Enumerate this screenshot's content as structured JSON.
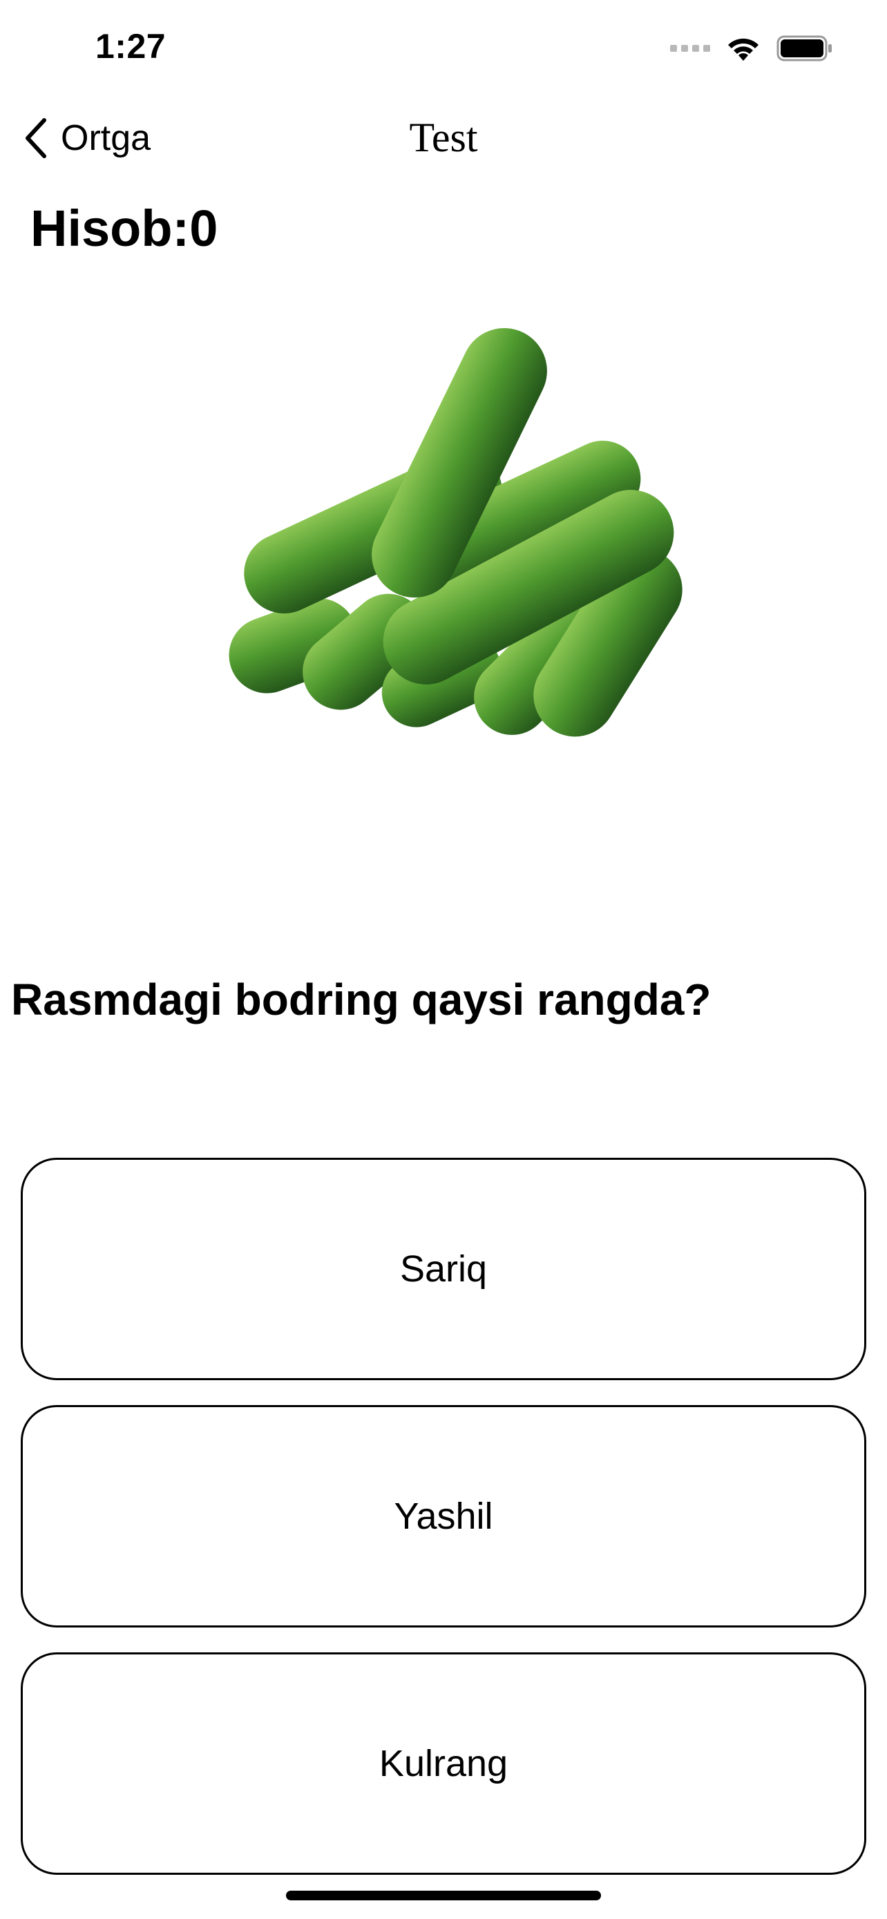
{
  "status_bar": {
    "time": "1:27"
  },
  "nav": {
    "back_label": "Ortga",
    "title": "Test"
  },
  "score": {
    "label": "Hisob:0"
  },
  "question": {
    "text": "Rasmdagi bodring qaysi rangda?"
  },
  "answers": [
    {
      "label": "Sariq"
    },
    {
      "label": "Yashil"
    },
    {
      "label": "Kulrang"
    }
  ],
  "colors": {
    "cucumber_dark": "#2e6b1f",
    "cucumber_mid": "#4f9a2f",
    "cucumber_light": "#8cc654"
  }
}
